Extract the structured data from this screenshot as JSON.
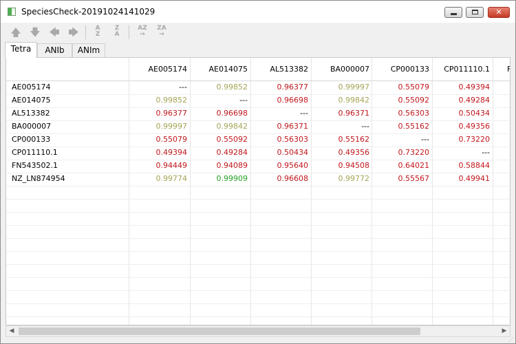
{
  "window": {
    "title": "SpeciesCheck-20191024141029"
  },
  "title_buttons": {
    "minimize": "─",
    "maximize": "□",
    "close": "✕"
  },
  "toolbar": {
    "move_up": "🡅",
    "move_down": "🡇",
    "move_left": "🡄",
    "move_right": "🡆",
    "sort_az_top": "A",
    "sort_az_bottom": "Z",
    "sort_za_top": "Z",
    "sort_za_bottom": "A",
    "sort_az_right_label": "AZ",
    "sort_za_right_label": "ZA",
    "arrow": "→"
  },
  "tabs": [
    {
      "label": "Tetra",
      "active": true
    },
    {
      "label": "ANIb",
      "active": false
    },
    {
      "label": "ANIm",
      "active": false
    }
  ],
  "table": {
    "columns": [
      "AE005174",
      "AE014075",
      "AL513382",
      "BA000007",
      "CP000133",
      "CP011110.1",
      "F"
    ],
    "rows": [
      {
        "label": "AE005174",
        "cells": [
          {
            "v": "---",
            "c": "n"
          },
          {
            "v": "0.99852",
            "c": "o"
          },
          {
            "v": "0.96377",
            "c": "r"
          },
          {
            "v": "0.99997",
            "c": "o"
          },
          {
            "v": "0.55079",
            "c": "r"
          },
          {
            "v": "0.49394",
            "c": "r"
          }
        ]
      },
      {
        "label": "AE014075",
        "cells": [
          {
            "v": "0.99852",
            "c": "o"
          },
          {
            "v": "---",
            "c": "n"
          },
          {
            "v": "0.96698",
            "c": "r"
          },
          {
            "v": "0.99842",
            "c": "o"
          },
          {
            "v": "0.55092",
            "c": "r"
          },
          {
            "v": "0.49284",
            "c": "r"
          }
        ]
      },
      {
        "label": "AL513382",
        "cells": [
          {
            "v": "0.96377",
            "c": "r"
          },
          {
            "v": "0.96698",
            "c": "r"
          },
          {
            "v": "---",
            "c": "n"
          },
          {
            "v": "0.96371",
            "c": "r"
          },
          {
            "v": "0.56303",
            "c": "r"
          },
          {
            "v": "0.50434",
            "c": "r"
          }
        ]
      },
      {
        "label": "BA000007",
        "cells": [
          {
            "v": "0.99997",
            "c": "o"
          },
          {
            "v": "0.99842",
            "c": "o"
          },
          {
            "v": "0.96371",
            "c": "r"
          },
          {
            "v": "---",
            "c": "n"
          },
          {
            "v": "0.55162",
            "c": "r"
          },
          {
            "v": "0.49356",
            "c": "r"
          }
        ]
      },
      {
        "label": "CP000133",
        "cells": [
          {
            "v": "0.55079",
            "c": "r"
          },
          {
            "v": "0.55092",
            "c": "r"
          },
          {
            "v": "0.56303",
            "c": "r"
          },
          {
            "v": "0.55162",
            "c": "r"
          },
          {
            "v": "---",
            "c": "n"
          },
          {
            "v": "0.73220",
            "c": "r"
          }
        ]
      },
      {
        "label": "CP011110.1",
        "cells": [
          {
            "v": "0.49394",
            "c": "r"
          },
          {
            "v": "0.49284",
            "c": "r"
          },
          {
            "v": "0.50434",
            "c": "r"
          },
          {
            "v": "0.49356",
            "c": "r"
          },
          {
            "v": "0.73220",
            "c": "r"
          },
          {
            "v": "---",
            "c": "n"
          }
        ]
      },
      {
        "label": "FN543502.1",
        "cells": [
          {
            "v": "0.94449",
            "c": "r"
          },
          {
            "v": "0.94089",
            "c": "r"
          },
          {
            "v": "0.95640",
            "c": "r"
          },
          {
            "v": "0.94508",
            "c": "r"
          },
          {
            "v": "0.64021",
            "c": "r"
          },
          {
            "v": "0.58844",
            "c": "r"
          }
        ]
      },
      {
        "label": "NZ_LN874954",
        "cells": [
          {
            "v": "0.99774",
            "c": "o"
          },
          {
            "v": "0.99909",
            "c": "g"
          },
          {
            "v": "0.96608",
            "c": "r"
          },
          {
            "v": "0.99772",
            "c": "o"
          },
          {
            "v": "0.55567",
            "c": "r"
          },
          {
            "v": "0.49941",
            "c": "r"
          }
        ]
      }
    ]
  },
  "colors": {
    "n": "#000000",
    "r": "#c0151b",
    "o": "#a4a455",
    "g": "#22a022",
    "toolbar_icon": "#a9a9a9"
  },
  "scrollbar": {
    "left_arrow": "◀",
    "right_arrow": "▶"
  },
  "size_grip": "⋰"
}
